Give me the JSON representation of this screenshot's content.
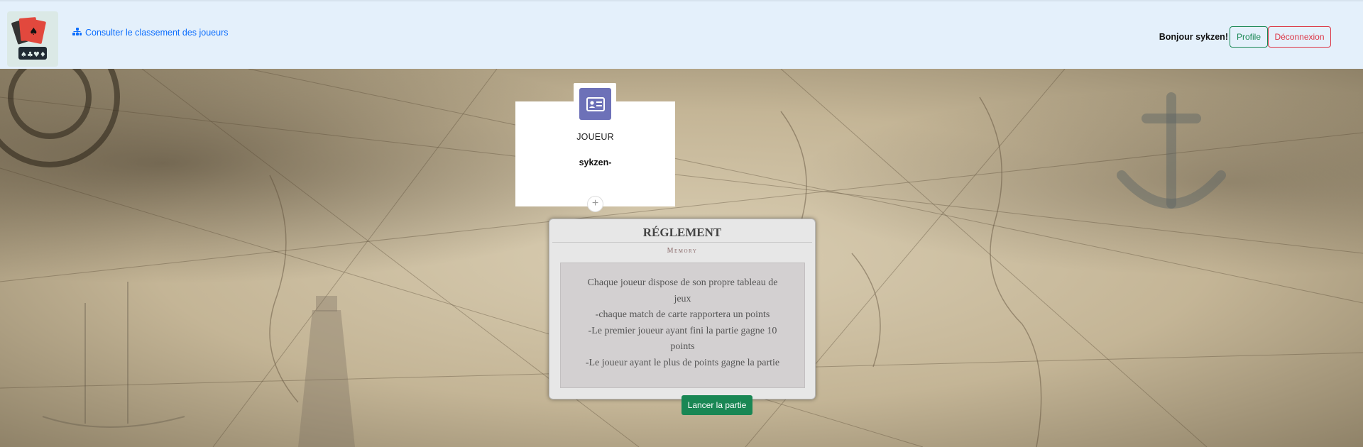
{
  "navbar": {
    "logo_icon": "playing-cards-logo-icon",
    "leaderboard_icon": "sitemap-icon",
    "leaderboard_link": "Consulter le classement des joueurs",
    "greeting": "Bonjour sykzen!",
    "profile_button": "Profile",
    "logout_button": "Déconnexion",
    "colors": {
      "profile": "#198754",
      "logout": "#dc3545",
      "link": "#0d6efd"
    }
  },
  "player": {
    "avatar_icon": "id-card-icon",
    "role": "JOUEUR",
    "name": "sykzen-",
    "add_icon": "plus-icon",
    "avatar_color": "#6d71b8"
  },
  "rules": {
    "title": "RÉGLEMENT",
    "subtitle": "Memory",
    "lines": [
      "Chaque joueur dispose de son propre tableau de jeux",
      "-chaque match de carte rapportera un points",
      "-Le premier joueur ayant fini la partie gagne 10 points",
      "-Le joueur ayant le plus de points gagne la partie"
    ]
  },
  "start_button": "Lancer la partie",
  "start_button_color": "#198754",
  "background": "vintage-world-map"
}
